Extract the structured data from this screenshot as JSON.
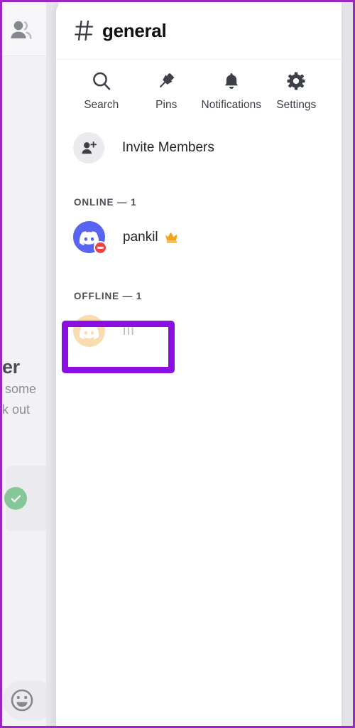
{
  "colors": {
    "annotation_purple": "#8B0FE0",
    "page_border_purple": "#9B26C4",
    "discord_blurple": "#5865F2",
    "dnd_red": "#ED4245",
    "offline_avatar_peach": "#FBDCB0",
    "crown_gold": "#F0A71F",
    "panel_white": "#FFFFFF",
    "gutter_gray": "#E2E2E7",
    "offline_name_gray": "#B9BBBE",
    "check_green": "#86C79A"
  },
  "background": {
    "members_icon": "members-icon",
    "heading_fragment": "er",
    "sub_fragment_1": "some",
    "sub_fragment_2": "k out",
    "check_icon": "check-circle-icon",
    "emoji_icon": "emoji-icon"
  },
  "panel": {
    "header": {
      "hash_icon": "hash-icon",
      "channel_name": "general"
    },
    "toolbar": [
      {
        "icon": "search-icon",
        "label": "Search"
      },
      {
        "icon": "pin-icon",
        "label": "Pins"
      },
      {
        "icon": "bell-icon",
        "label": "Notifications"
      },
      {
        "icon": "gear-icon",
        "label": "Settings"
      }
    ],
    "invite": {
      "icon": "person-add-icon",
      "label": "Invite Members"
    },
    "online_section": {
      "header": "ONLINE — 1",
      "members": [
        {
          "name": "pankil",
          "avatar_icon": "discord-logo-avatar",
          "status": "dnd",
          "badge_icon": "do-not-disturb-icon",
          "role_icon": "crown-icon"
        }
      ]
    },
    "offline_section": {
      "header": "OFFLINE — 1",
      "members": [
        {
          "name": "iii",
          "avatar_icon": "discord-logo-avatar",
          "status": "offline"
        }
      ]
    }
  }
}
